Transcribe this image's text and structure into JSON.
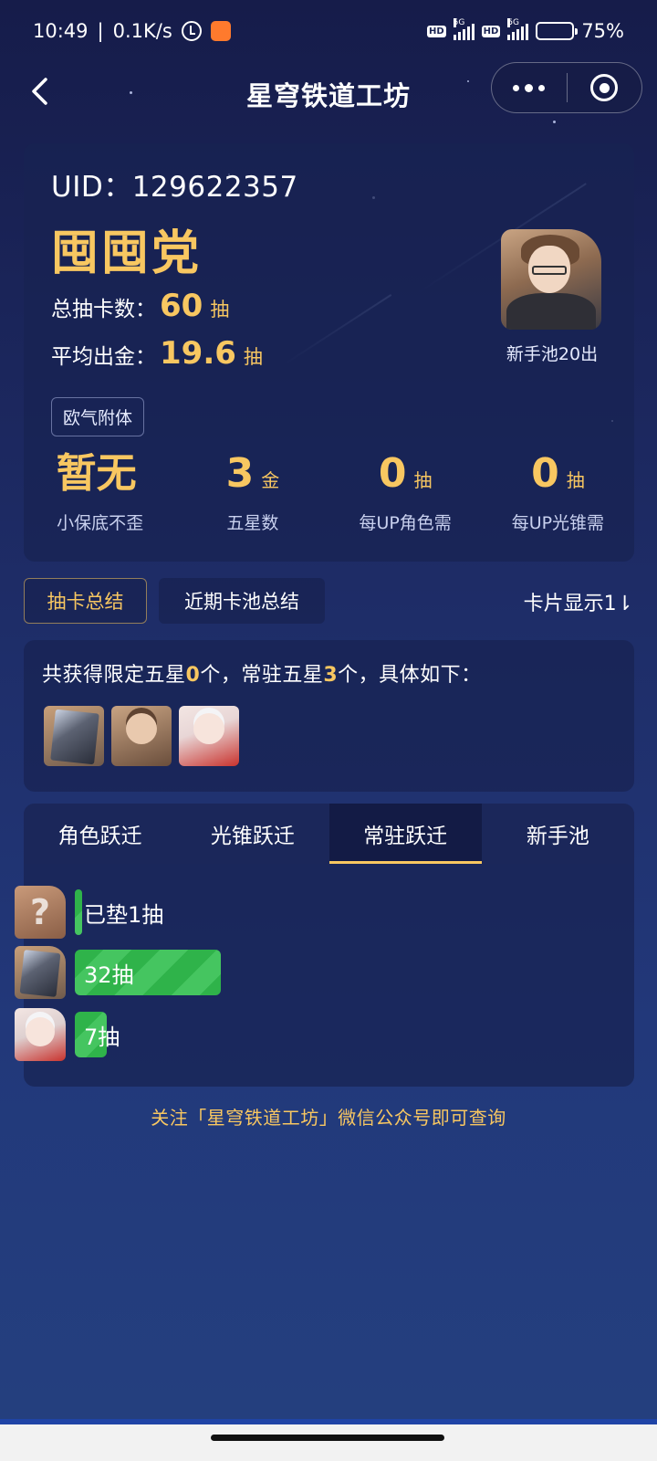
{
  "statusbar": {
    "time": "10:49",
    "net_speed": "0.1K/s",
    "hd_badge": "HD",
    "network_type": "5G",
    "battery": "75%"
  },
  "nav": {
    "title": "星穹铁道工坊"
  },
  "profile": {
    "uid": "UID：129622357",
    "nickname": "囤囤党",
    "total_label": "总抽卡数：",
    "total_value": "60",
    "avg_label": "平均出金：",
    "avg_value": "19.6",
    "unit_pull": "抽",
    "luck_tag": "欧气附体",
    "avatar_caption": "新手池20出"
  },
  "stats": [
    {
      "value": "暂无",
      "unit": "",
      "label": "小保底不歪"
    },
    {
      "value": "3",
      "unit": "金",
      "label": "五星数"
    },
    {
      "value": "0",
      "unit": "抽",
      "label": "每UP角色需"
    },
    {
      "value": "0",
      "unit": "抽",
      "label": "每UP光锥需"
    }
  ],
  "summary_tabs": {
    "active": "抽卡总结",
    "other": "近期卡池总结",
    "card_display": "卡片显示1⇂"
  },
  "summary": {
    "prefix": "共获得限定五星",
    "limited_count": "0",
    "mid": "个，常驻五星",
    "standard_count": "3",
    "suffix": "个，具体如下："
  },
  "pool_tabs": [
    "角色跃迁",
    "光锥跃迁",
    "常驻跃迁",
    "新手池"
  ],
  "active_pool_tab": "常驻跃迁",
  "pulls": [
    {
      "label": "已垫1抽",
      "count": 1,
      "icon": "unknown-character-icon",
      "unknown_mark": "?"
    },
    {
      "label": "32抽",
      "count": 32,
      "icon": "light-cone-icon"
    },
    {
      "label": "7抽",
      "count": 7,
      "icon": "white-hair-character-icon"
    }
  ],
  "footer_note": "关注「星穹铁道工坊」微信公众号即可查询",
  "colors": {
    "gold": "#f8c761",
    "bar_green": "#2fb34a",
    "card_bg": "#182352",
    "tab_underline": "#f8c761"
  }
}
